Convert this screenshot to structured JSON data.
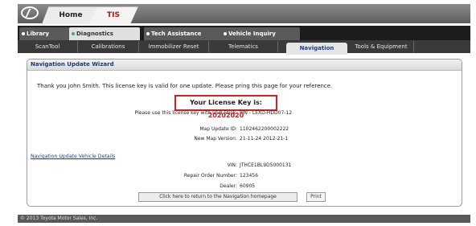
{
  "app_tabs": {
    "home": "Home",
    "tis": "TIS"
  },
  "main_nav": {
    "items": [
      {
        "label": "Library",
        "active": false
      },
      {
        "label": "Diagnostics",
        "active": true
      },
      {
        "label": "Tech Assistance",
        "active": false
      },
      {
        "label": "Vehicle Inquiry",
        "active": false
      }
    ]
  },
  "sub_nav": {
    "items": [
      {
        "label": "ScanTool"
      },
      {
        "label": "Calibrations"
      },
      {
        "label": "Immobilizer Reset"
      },
      {
        "label": "Telematics"
      },
      {
        "label": "Navigation",
        "active": true
      },
      {
        "label": "Tools & Equipment"
      }
    ]
  },
  "wizard": {
    "title": "Navigation Update Wizard",
    "thanks_text": "Thank you John Smith.  This license key is valid for one update.  Please pring this page for your reference.",
    "license_key_label": "Your License Key is:",
    "license_key": "20202020",
    "usb_label": "Please use this license key with USB Stick:",
    "usb_value": "PIN - LEXD-HDD07-12",
    "map_update_id_label": "Map Update ID:",
    "map_update_id": "1102462200002222",
    "map_version_label": "New Map Version:",
    "map_version": "21-11-24 2012-21-1",
    "details_link": "Navigation Update Vehicle Details",
    "vin_label": "VIN:",
    "vin": "JTHCE1BL9D5000131",
    "repair_order_label": "Repair Order Number:",
    "repair_order": "123456",
    "dealer_label": "Dealer:",
    "dealer": "60905",
    "return_button": "Click here to return to the Navigation homepage",
    "print_button": "Print"
  },
  "footer": "© 2013 Toyota Motor Sales, Inc.",
  "colors": {
    "accent_red": "#d61f1f",
    "link_blue": "#1d3d8c",
    "nav_dark": "#1c1c1c"
  }
}
